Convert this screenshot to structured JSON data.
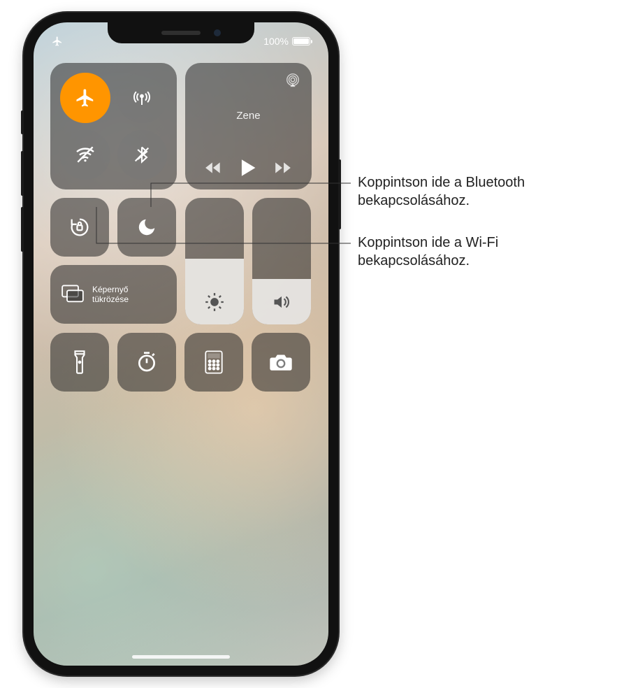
{
  "status": {
    "battery_pct": "100%"
  },
  "connectivity": {
    "airplane_active": true
  },
  "music": {
    "title": "Zene"
  },
  "mirror": {
    "line1": "Képernyő",
    "line2": "tükrözése"
  },
  "callouts": {
    "bluetooth": "Koppintson ide a Bluetooth bekapcsolásához.",
    "wifi": "Koppintson ide a Wi-Fi bekapcsolásához."
  }
}
